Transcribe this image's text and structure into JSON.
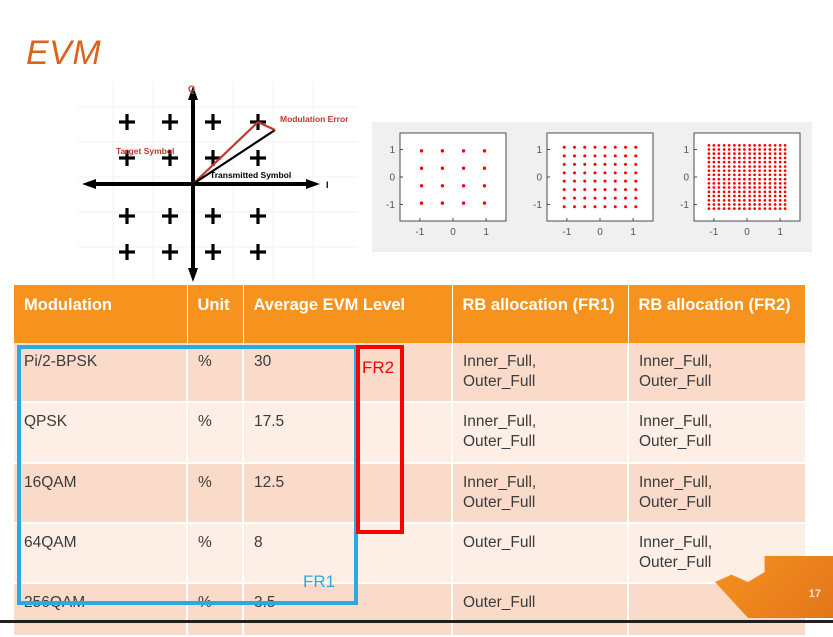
{
  "slide": {
    "title": "EVM",
    "page_number": "17",
    "title_color": "#D9641E"
  },
  "evm_diagram": {
    "axis_label_q": "Q",
    "axis_label_i": "I",
    "annotations": [
      {
        "name": "modulation-error",
        "text": "Modulation Error",
        "color": "#C0392B"
      },
      {
        "name": "target-symbol",
        "text": "Target Symbol",
        "color": "#C0392B"
      },
      {
        "name": "transmitted-symbol",
        "text": "Transmitted Symbol",
        "color": "#000000"
      }
    ],
    "constellation_marker": "+",
    "grid_rows": 4,
    "grid_cols": 4
  },
  "chart_data": [
    {
      "type": "scatter",
      "name": "16QAM constellation",
      "title": "",
      "xlabel": "",
      "ylabel": "",
      "xticks": [
        -1,
        0,
        1
      ],
      "yticks": [
        -1,
        0,
        1
      ],
      "xlim": [
        -1.6,
        1.6
      ],
      "ylim": [
        -1.6,
        1.6
      ],
      "grid": false,
      "marker_color": "#FF0000",
      "levels": [
        -0.95,
        -0.32,
        0.32,
        0.95
      ],
      "points_per_axis": 4,
      "point_count": 16
    },
    {
      "type": "scatter",
      "name": "64QAM constellation",
      "title": "",
      "xlabel": "",
      "ylabel": "",
      "xticks": [
        -1,
        0,
        1
      ],
      "yticks": [
        -1,
        0,
        1
      ],
      "xlim": [
        -1.6,
        1.6
      ],
      "ylim": [
        -1.6,
        1.6
      ],
      "grid": false,
      "marker_color": "#FF0000",
      "levels": [
        -1.08,
        -0.77,
        -0.46,
        -0.15,
        0.15,
        0.46,
        0.77,
        1.08
      ],
      "points_per_axis": 8,
      "point_count": 64
    },
    {
      "type": "scatter",
      "name": "256QAM constellation",
      "title": "",
      "xlabel": "",
      "ylabel": "",
      "xticks": [
        -1,
        0,
        1
      ],
      "yticks": [
        -1,
        0,
        1
      ],
      "xlim": [
        -1.6,
        1.6
      ],
      "ylim": [
        -1.6,
        1.6
      ],
      "grid": false,
      "marker_color": "#FF0000",
      "levels": [
        -1.15,
        -1.0,
        -0.85,
        -0.69,
        -0.54,
        -0.38,
        -0.23,
        -0.08,
        0.08,
        0.23,
        0.38,
        0.54,
        0.69,
        0.85,
        1.0,
        1.15
      ],
      "points_per_axis": 16,
      "point_count": 256
    }
  ],
  "table": {
    "headers": [
      "Modulation",
      "Unit",
      "Average EVM Level",
      "RB allocation (FR1)",
      "RB allocation (FR2)"
    ],
    "rows": [
      {
        "modulation": "Pi/2-BPSK",
        "unit": "%",
        "evm": "30",
        "rb_fr1": "Inner_Full,\nOuter_Full",
        "rb_fr2": "Inner_Full,\nOuter_Full"
      },
      {
        "modulation": "QPSK",
        "unit": "%",
        "evm": "17.5",
        "rb_fr1": "Inner_Full,\nOuter_Full",
        "rb_fr2": "Inner_Full,\nOuter_Full"
      },
      {
        "modulation": "16QAM",
        "unit": "%",
        "evm": "12.5",
        "rb_fr1": "Inner_Full,\nOuter_Full",
        "rb_fr2": "Inner_Full,\nOuter_Full"
      },
      {
        "modulation": "64QAM",
        "unit": "%",
        "evm": "8",
        "rb_fr1": "Outer_Full",
        "rb_fr2": "Inner_Full,\nOuter_Full"
      },
      {
        "modulation": "256QAM",
        "unit": "%",
        "evm": "3.5",
        "rb_fr1": "Outer_Full",
        "rb_fr2": ""
      }
    ],
    "header_bg": "#F6921E",
    "row_bg_dark": "#FADBCA",
    "row_bg_light": "#FDEEE6"
  },
  "annotations": {
    "fr1_label": "FR1",
    "fr1_color": "#29ABE2",
    "fr2_label": "FR2",
    "fr2_color": "#FF0000"
  }
}
